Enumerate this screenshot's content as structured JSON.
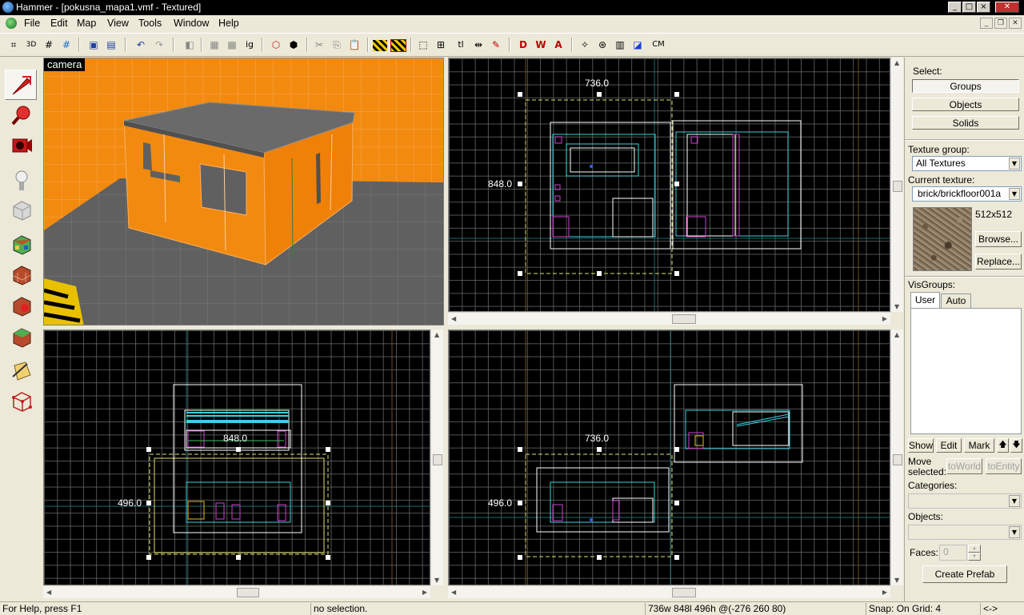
{
  "window": {
    "title": "Hammer - [pokusna_mapa1.vmf - Textured]"
  },
  "menu": [
    "File",
    "Edit",
    "Map",
    "View",
    "Tools",
    "Window",
    "Help"
  ],
  "toolbar": {
    "buttons": [
      "grid-toggle",
      "grid-3d",
      "grid-smaller",
      "grid-larger",
      "group",
      "ungroup",
      "undo",
      "redo",
      "carve",
      "hollow",
      "clip",
      "cut",
      "copy",
      "paste",
      "hide",
      "show",
      "texture-lock",
      "snap-grid",
      "toggle-texture",
      "flip",
      "cordon",
      "show-entities",
      "show-world",
      "show-all",
      "vertex",
      "cordon-box",
      "cm"
    ],
    "text_labels": {
      "ignore": "ig",
      "tl": "tl",
      "cm": "CM"
    }
  },
  "tools": [
    "selection-tool",
    "magnify-tool",
    "camera-tool",
    "entity-tool",
    "block-tool",
    "texture-application-tool",
    "apply-current-texture-tool",
    "decal-tool",
    "overlay-tool",
    "clipping-tool",
    "vertex-tool"
  ],
  "viewports": {
    "camera": {
      "label": "camera"
    },
    "top": {
      "width_label": "736.0",
      "height_label": "848.0"
    },
    "front": {
      "width_label": "848.0",
      "height_label": "496.0"
    },
    "side": {
      "width_label": "736.0",
      "height_label": "496.0"
    }
  },
  "panel": {
    "select_label": "Select:",
    "groups_button": "Groups",
    "objects_button": "Objects",
    "solids_button": "Solids",
    "texture_group_label": "Texture group:",
    "texture_group_value": "All Textures",
    "current_texture_label": "Current texture:",
    "current_texture_value": "brick/brickfloor001a",
    "texture_size": "512x512",
    "browse_button": "Browse...",
    "replace_button": "Replace...",
    "visgroups_label": "VisGroups:",
    "tab_user": "User",
    "tab_auto": "Auto",
    "show_button": "Show",
    "edit_button": "Edit",
    "mark_button": "Mark",
    "move_selected_label_1": "Move",
    "move_selected_label_2": "selected:",
    "to_world_button": "toWorld",
    "to_entity_button": "toEntity",
    "categories_label": "Categories:",
    "objects_label": "Objects:",
    "faces_label": "Faces:",
    "faces_value": "0",
    "create_prefab_button": "Create Prefab"
  },
  "status": {
    "help": "For Help, press F1",
    "selection": "no selection.",
    "dimensions": "736w 848l 496h @(-276 260 80)",
    "snap": "Snap: On Grid: 4",
    "extra": "<->"
  },
  "colors": {
    "viewport_bg": "#000000",
    "grid": "#6e6e6e",
    "wall_orange": "#f28a10",
    "roof_gray": "#6a6a6a",
    "brush_cyan": "#3ad0e0",
    "brush_magenta": "#d040d0",
    "selection_yellow": "#e0e070"
  }
}
